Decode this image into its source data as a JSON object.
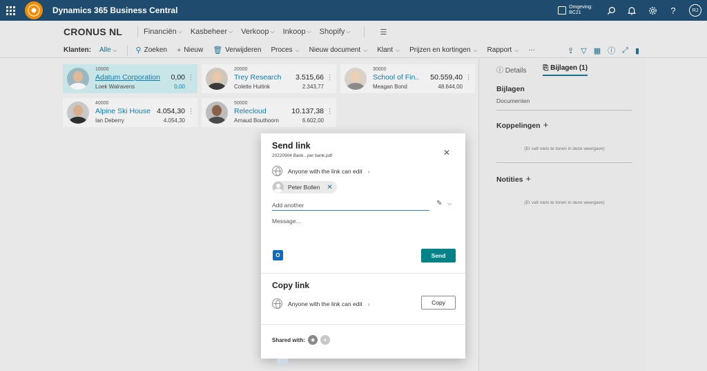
{
  "app": {
    "title": "Dynamics 365 Business Central",
    "environment_label": "Omgeving:",
    "environment_value": "BC21",
    "user_initials": "RJ"
  },
  "nav": {
    "company": "CRONUS NL",
    "items": [
      "Financiën",
      "Kasbeheer",
      "Verkoop",
      "Inkoop",
      "Shopify"
    ]
  },
  "actions": {
    "klanten_label": "Klanten:",
    "filter_value": "Alle",
    "zoeken": "Zoeken",
    "nieuw": "Nieuw",
    "verwijderen": "Verwijderen",
    "proces": "Proces",
    "nieuw_document": "Nieuw document",
    "klant": "Klant",
    "prijzen": "Prijzen en kortingen",
    "rapport": "Rapport",
    "more": "···"
  },
  "tiles": [
    {
      "no": "10000",
      "name": "Adatum Corporation",
      "contact": "Loek Walravens",
      "amount": "0,00",
      "amount2": "0,00",
      "selected": true
    },
    {
      "no": "20000",
      "name": "Trey Research",
      "contact": "Colette Huitink",
      "amount": "3.515,66",
      "amount2": "2.343,77",
      "selected": false
    },
    {
      "no": "30000",
      "name": "School of Fin...",
      "contact": "Meagan Bond",
      "amount": "50.559,40",
      "amount2": "48.644,00",
      "selected": false
    },
    {
      "no": "40000",
      "name": "Alpine Ski House",
      "contact": "Ian Deberry",
      "amount": "4.054,30",
      "amount2": "4.054,30",
      "selected": false
    },
    {
      "no": "50000",
      "name": "Relecloud",
      "contact": "Arnaud Bouthoorn",
      "amount": "10.137,38",
      "amount2": "6.602,00",
      "selected": false
    }
  ],
  "pane": {
    "tab_details": "Details",
    "tab_bijlagen": "Bijlagen (1)",
    "bijlagen_title": "Bijlagen",
    "documenten": "Documenten",
    "koppelingen": "Koppelingen",
    "empty_text": "(Er valt niets te tonen in deze weergave)",
    "notities": "Notities"
  },
  "dialog": {
    "title": "Send link",
    "filename": "20220904 Bank...per bank.pdf",
    "permission": "Anyone with the link can edit",
    "recipient": "Peter Bollen",
    "add_placeholder": "Add another",
    "message_placeholder": "Message...",
    "send_label": "Send",
    "copy_title": "Copy link",
    "copy_permission": "Anyone with the link can edit",
    "copy_label": "Copy",
    "shared_with": "Shared with:"
  },
  "colors": {
    "topbar": "#1e4b6e",
    "accent": "#038387",
    "link": "#0d7bab",
    "selected_tile": "#c8e6e8"
  }
}
